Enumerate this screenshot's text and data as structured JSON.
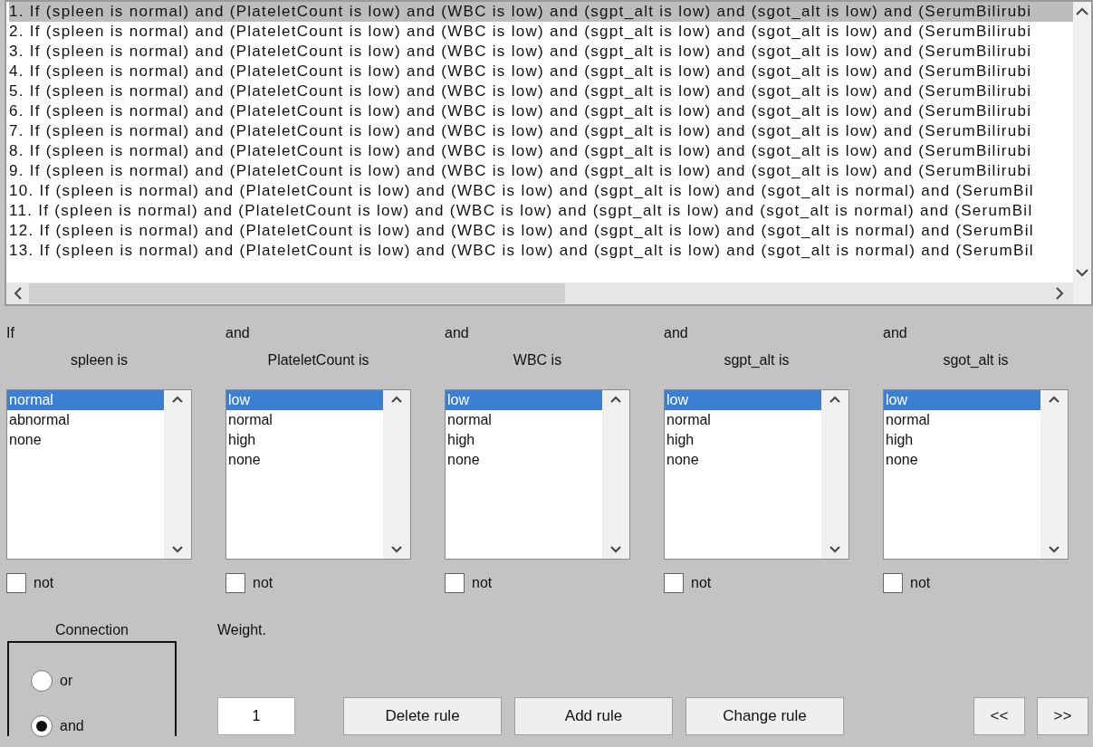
{
  "rule_list": {
    "rows": [
      {
        "text": "1. If (spleen is normal) and (PlateletCount is low) and (WBC is low) and (sgpt_alt is low) and (sgot_alt is low) and (SerumBilirubi",
        "selected": true
      },
      {
        "text": "2. If (spleen is normal) and (PlateletCount is low) and (WBC is low) and (sgpt_alt is low) and (sgot_alt is low) and (SerumBilirubi",
        "selected": false
      },
      {
        "text": "3. If (spleen is normal) and (PlateletCount is low) and (WBC is low) and (sgpt_alt is low) and (sgot_alt is low) and (SerumBilirubi",
        "selected": false
      },
      {
        "text": "4. If (spleen is normal) and (PlateletCount is low) and (WBC is low) and (sgpt_alt is low) and (sgot_alt is low) and (SerumBilirubi",
        "selected": false
      },
      {
        "text": "5. If (spleen is normal) and (PlateletCount is low) and (WBC is low) and (sgpt_alt is low) and (sgot_alt is low) and (SerumBilirubi",
        "selected": false
      },
      {
        "text": "6. If (spleen is normal) and (PlateletCount is low) and (WBC is low) and (sgpt_alt is low) and (sgot_alt is low) and (SerumBilirubi",
        "selected": false
      },
      {
        "text": "7. If (spleen is normal) and (PlateletCount is low) and (WBC is low) and (sgpt_alt is low) and (sgot_alt is low) and (SerumBilirubi",
        "selected": false
      },
      {
        "text": "8. If (spleen is normal) and (PlateletCount is low) and (WBC is low) and (sgpt_alt is low) and (sgot_alt is low) and (SerumBilirubi",
        "selected": false
      },
      {
        "text": "9. If (spleen is normal) and (PlateletCount is low) and (WBC is low) and (sgpt_alt is low) and (sgot_alt is low) and (SerumBilirubi",
        "selected": false
      },
      {
        "text": "10. If (spleen is normal) and (PlateletCount is low) and (WBC is low) and (sgpt_alt is low) and (sgot_alt is normal) and (SerumBil",
        "selected": false
      },
      {
        "text": "11. If (spleen is normal) and (PlateletCount is low) and (WBC is low) and (sgpt_alt is low) and (sgot_alt is normal) and (SerumBil",
        "selected": false
      },
      {
        "text": "12. If (spleen is normal) and (PlateletCount is low) and (WBC is low) and (sgpt_alt is low) and (sgot_alt is normal) and (SerumBil",
        "selected": false
      },
      {
        "text": "13. If (spleen is normal) and (PlateletCount is low) and (WBC is low) and (sgpt_alt is low) and (sgot_alt is normal) and (SerumBil",
        "selected": false
      }
    ]
  },
  "conditions": [
    {
      "connector": "If",
      "heading": "spleen is",
      "options": [
        {
          "label": "normal",
          "selected": true
        },
        {
          "label": "abnormal",
          "selected": false
        },
        {
          "label": "none",
          "selected": false
        }
      ],
      "not": {
        "label": "not",
        "checked": false
      }
    },
    {
      "connector": "and",
      "heading": "PlateletCount is",
      "options": [
        {
          "label": "low",
          "selected": true
        },
        {
          "label": "normal",
          "selected": false
        },
        {
          "label": "high",
          "selected": false
        },
        {
          "label": "none",
          "selected": false
        }
      ],
      "not": {
        "label": "not",
        "checked": false
      }
    },
    {
      "connector": "and",
      "heading": "WBC is",
      "options": [
        {
          "label": "low",
          "selected": true
        },
        {
          "label": "normal",
          "selected": false
        },
        {
          "label": "high",
          "selected": false
        },
        {
          "label": "none",
          "selected": false
        }
      ],
      "not": {
        "label": "not",
        "checked": false
      }
    },
    {
      "connector": "and",
      "heading": "sgpt_alt is",
      "options": [
        {
          "label": "low",
          "selected": true
        },
        {
          "label": "normal",
          "selected": false
        },
        {
          "label": "high",
          "selected": false
        },
        {
          "label": "none",
          "selected": false
        }
      ],
      "not": {
        "label": "not",
        "checked": false
      }
    },
    {
      "connector": "and",
      "heading": "sgot_alt is",
      "options": [
        {
          "label": "low",
          "selected": true
        },
        {
          "label": "normal",
          "selected": false
        },
        {
          "label": "high",
          "selected": false
        },
        {
          "label": "none",
          "selected": false
        }
      ],
      "not": {
        "label": "not",
        "checked": false
      }
    }
  ],
  "connection": {
    "title": "Connection",
    "options": [
      {
        "label": "or",
        "selected": false
      },
      {
        "label": "and",
        "selected": true
      }
    ]
  },
  "weight": {
    "label": "Weight.",
    "value": "1"
  },
  "buttons": [
    "Delete rule",
    "Add rule",
    "Change rule"
  ],
  "nav_buttons": [
    "<<",
    ">>"
  ]
}
